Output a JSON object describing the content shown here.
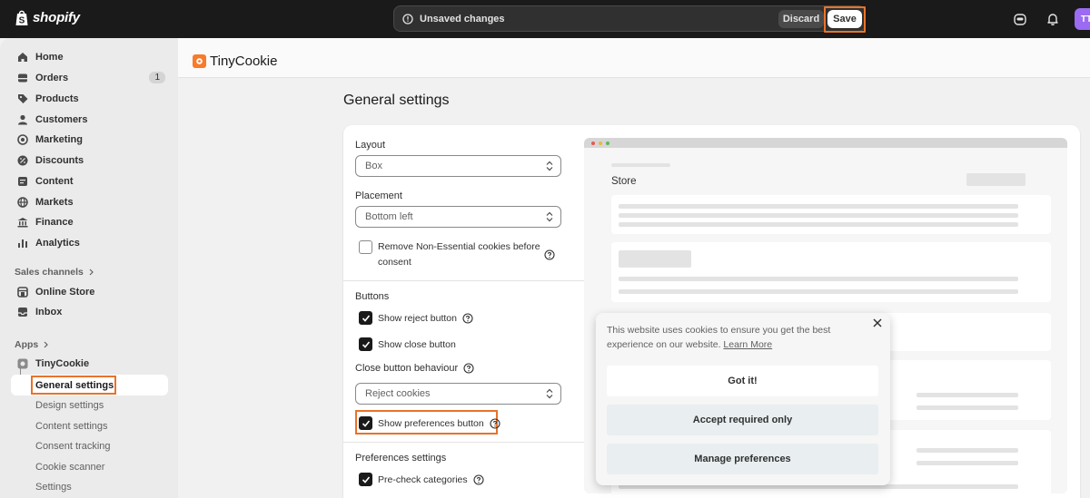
{
  "topbar": {
    "brand": "shopify",
    "unsaved_text": "Unsaved changes",
    "discard_label": "Discard",
    "save_label": "Save",
    "avatar_initials": "TT"
  },
  "sidebar": {
    "items": [
      {
        "label": "Home",
        "icon": "home-icon"
      },
      {
        "label": "Orders",
        "icon": "orders-icon",
        "badge": "1"
      },
      {
        "label": "Products",
        "icon": "tag-icon"
      },
      {
        "label": "Customers",
        "icon": "person-icon"
      },
      {
        "label": "Marketing",
        "icon": "target-icon"
      },
      {
        "label": "Discounts",
        "icon": "discount-icon"
      },
      {
        "label": "Content",
        "icon": "content-icon"
      },
      {
        "label": "Markets",
        "icon": "globe-icon"
      },
      {
        "label": "Finance",
        "icon": "bank-icon"
      },
      {
        "label": "Analytics",
        "icon": "bar-chart-icon"
      }
    ],
    "sales_channels_heading": "Sales channels",
    "channels": [
      {
        "label": "Online Store",
        "icon": "store-icon"
      },
      {
        "label": "Inbox",
        "icon": "inbox-icon"
      }
    ],
    "apps_heading": "Apps",
    "app_name": "TinyCookie",
    "app_sub_items": [
      "General settings",
      "Design settings",
      "Content settings",
      "Consent tracking",
      "Cookie scanner",
      "Settings"
    ]
  },
  "app_header": {
    "title": "TinyCookie"
  },
  "page": {
    "title": "General settings"
  },
  "form": {
    "layout_label": "Layout",
    "layout_value": "Box",
    "placement_label": "Placement",
    "placement_value": "Bottom left",
    "remove_nonessential_label_1": "Remove Non-Essential cookies before",
    "remove_nonessential_label_2": "consent",
    "buttons_heading": "Buttons",
    "show_reject_label": "Show reject button",
    "show_close_label": "Show close button",
    "close_behaviour_label": "Close button behaviour",
    "close_behaviour_value": "Reject cookies",
    "show_preferences_label": "Show preferences button",
    "preferences_heading": "Preferences settings",
    "precheck_label": "Pre-check categories"
  },
  "preview": {
    "store_label": "Store",
    "cookie_text": "This website uses cookies to ensure you get the best experience on our website.",
    "learn_more": "Learn More",
    "got_it": "Got it!",
    "accept_required": "Accept required only",
    "manage_preferences": "Manage preferences"
  },
  "colors": {
    "accent_orange": "#e8732a",
    "topbar_bg": "#1a1a1a",
    "avatar_bg": "#9b6bf2",
    "app_logo": "#f77b2a"
  }
}
